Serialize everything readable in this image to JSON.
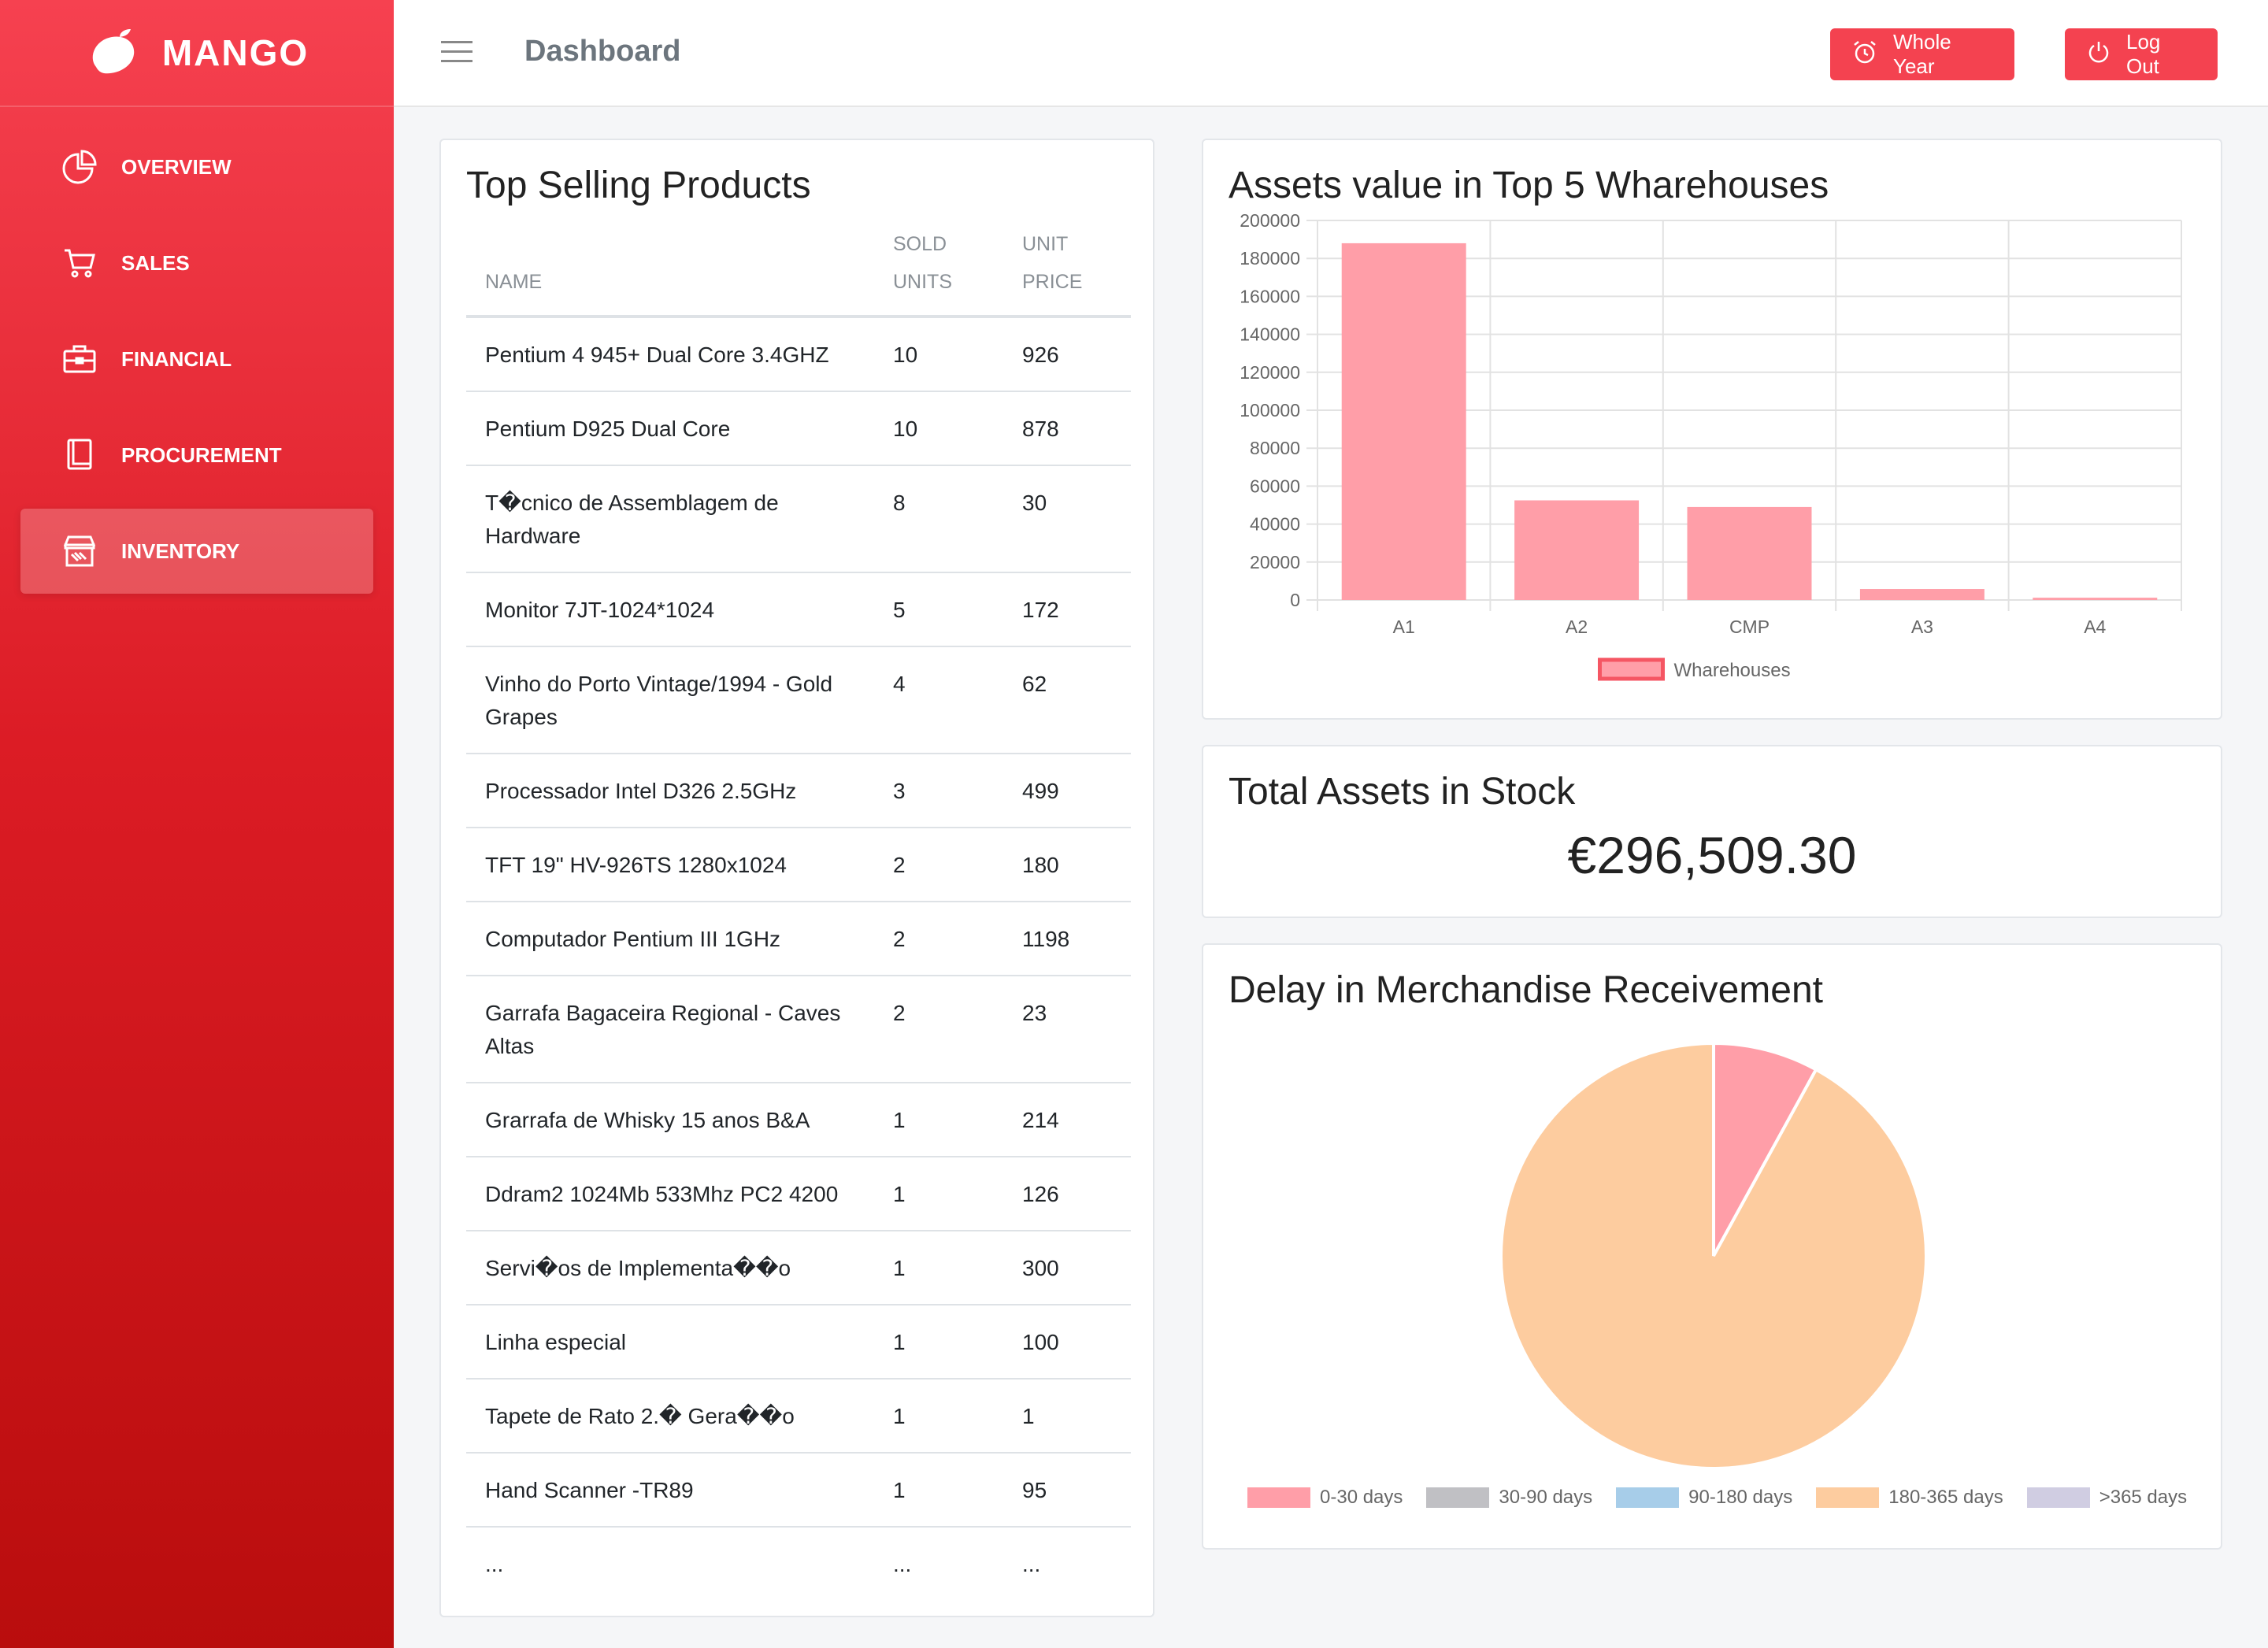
{
  "brand": {
    "name": "MANGO"
  },
  "sidebar": {
    "items": [
      {
        "label": "OVERVIEW",
        "icon": "pie-chart-icon"
      },
      {
        "label": "SALES",
        "icon": "cart-icon"
      },
      {
        "label": "FINANCIAL",
        "icon": "briefcase-icon"
      },
      {
        "label": "PROCUREMENT",
        "icon": "book-icon"
      },
      {
        "label": "INVENTORY",
        "icon": "store-icon",
        "active": true
      }
    ]
  },
  "header": {
    "title": "Dashboard",
    "year_button": "Whole Year",
    "logout_button": "Log Out"
  },
  "top_products": {
    "title": "Top Selling Products",
    "columns": {
      "name": "NAME",
      "units": "SOLD UNITS",
      "price": "UNIT PRICE"
    },
    "rows": [
      {
        "name": "Pentium 4 945+ Dual Core 3.4GHZ",
        "units": "10",
        "price": "926"
      },
      {
        "name": "Pentium D925 Dual Core",
        "units": "10",
        "price": "878"
      },
      {
        "name": "T�cnico de Assemblagem de Hardware",
        "units": "8",
        "price": "30"
      },
      {
        "name": "Monitor 7JT-1024*1024",
        "units": "5",
        "price": "172"
      },
      {
        "name": "Vinho do Porto Vintage/1994 - Gold Grapes",
        "units": "4",
        "price": "62"
      },
      {
        "name": "Processador Intel D326 2.5GHz",
        "units": "3",
        "price": "499"
      },
      {
        "name": "TFT 19\" HV-926TS 1280x1024",
        "units": "2",
        "price": "180"
      },
      {
        "name": "Computador Pentium III 1GHz",
        "units": "2",
        "price": "1198"
      },
      {
        "name": "Garrafa Bagaceira Regional - Caves Altas",
        "units": "2",
        "price": "23"
      },
      {
        "name": "Grarrafa de Whisky 15 anos B&A",
        "units": "1",
        "price": "214"
      },
      {
        "name": "Ddram2 1024Mb 533Mhz PC2 4200",
        "units": "1",
        "price": "126"
      },
      {
        "name": "Servi�os de Implementa��o",
        "units": "1",
        "price": "300"
      },
      {
        "name": "Linha especial",
        "units": "1",
        "price": "100"
      },
      {
        "name": "Tapete de Rato 2.� Gera��o",
        "units": "1",
        "price": "1"
      },
      {
        "name": "Hand Scanner -TR89",
        "units": "1",
        "price": "95"
      },
      {
        "name": "...",
        "units": "...",
        "price": "..."
      }
    ]
  },
  "chart_data": [
    {
      "type": "bar",
      "title": "Assets value in Top 5 Wharehouses",
      "categories": [
        "A1",
        "A2",
        "CMP",
        "A3",
        "A4"
      ],
      "series": [
        {
          "name": "Wharehouses",
          "values": [
            188000,
            52500,
            49000,
            5800,
            1200
          ]
        }
      ],
      "ylim": [
        0,
        200000
      ],
      "yticks": [
        0,
        20000,
        40000,
        60000,
        80000,
        100000,
        120000,
        140000,
        160000,
        180000,
        200000
      ],
      "colors": {
        "fill": "#ff9ea8",
        "border": "#f55663"
      },
      "grid": true,
      "legend": "bottom"
    },
    {
      "type": "pie",
      "title": "Delay in Merchandise Receivement",
      "categories": [
        "0-30 days",
        "30-90 days",
        "90-180 days",
        "180-365 days",
        ">365 days"
      ],
      "values": [
        8,
        0,
        0,
        92,
        0
      ],
      "colors": [
        "#ff9ea8",
        "#c0c0c4",
        "#a7cde9",
        "#fdcc9f",
        "#d0cde2"
      ],
      "legend": "bottom"
    }
  ],
  "total_assets": {
    "title": "Total Assets in Stock",
    "value": "€296,509.30"
  }
}
